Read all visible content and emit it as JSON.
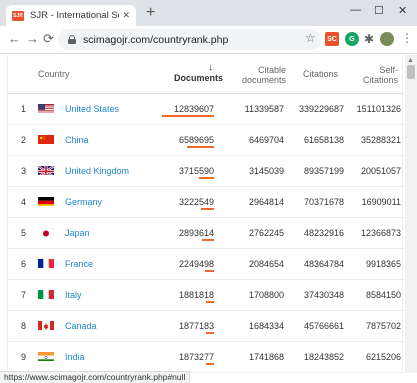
{
  "browser": {
    "tab_title": "SJR - International Science Rank",
    "favicon_text": "SJR",
    "tab_close": "✕",
    "new_tab": "+",
    "url": "scimagojr.com/countryrank.php",
    "status_url": "https://www.scimagojr.com/countryrank.php#null",
    "extensions": {
      "sc": "SC",
      "g": "G"
    }
  },
  "table": {
    "headers": {
      "country": "Country",
      "documents": "Documents",
      "citable_line1": "Citable",
      "citable_line2": "documents",
      "citations": "Citations",
      "self_line1": "Self-",
      "self_line2": "Citations"
    },
    "sort_arrow": "↓",
    "rows": [
      {
        "rank": "1",
        "country": "United States",
        "documents": "12839607",
        "citable": "11339587",
        "citations": "339229687",
        "self": "151101326"
      },
      {
        "rank": "2",
        "country": "China",
        "documents": "6589695",
        "citable": "6469704",
        "citations": "61658138",
        "self": "35288321"
      },
      {
        "rank": "3",
        "country": "United Kingdom",
        "documents": "3715590",
        "citable": "3145039",
        "citations": "89357199",
        "self": "20051057"
      },
      {
        "rank": "4",
        "country": "Germany",
        "documents": "3222549",
        "citable": "2964814",
        "citations": "70371678",
        "self": "16909011"
      },
      {
        "rank": "5",
        "country": "Japan",
        "documents": "2893614",
        "citable": "2762245",
        "citations": "48232916",
        "self": "12366873"
      },
      {
        "rank": "6",
        "country": "France",
        "documents": "2249498",
        "citable": "2084654",
        "citations": "48364784",
        "self": "9918365"
      },
      {
        "rank": "7",
        "country": "Italy",
        "documents": "1881818",
        "citable": "1708800",
        "citations": "37430348",
        "self": "8584150"
      },
      {
        "rank": "8",
        "country": "Canada",
        "documents": "1877183",
        "citable": "1684334",
        "citations": "45766661",
        "self": "7875702"
      },
      {
        "rank": "9",
        "country": "India",
        "documents": "1873277",
        "citable": "1741868",
        "citations": "18243852",
        "self": "6215206"
      }
    ]
  },
  "colors": {
    "bar": "#f06b2b",
    "link": "#1e88c7"
  }
}
